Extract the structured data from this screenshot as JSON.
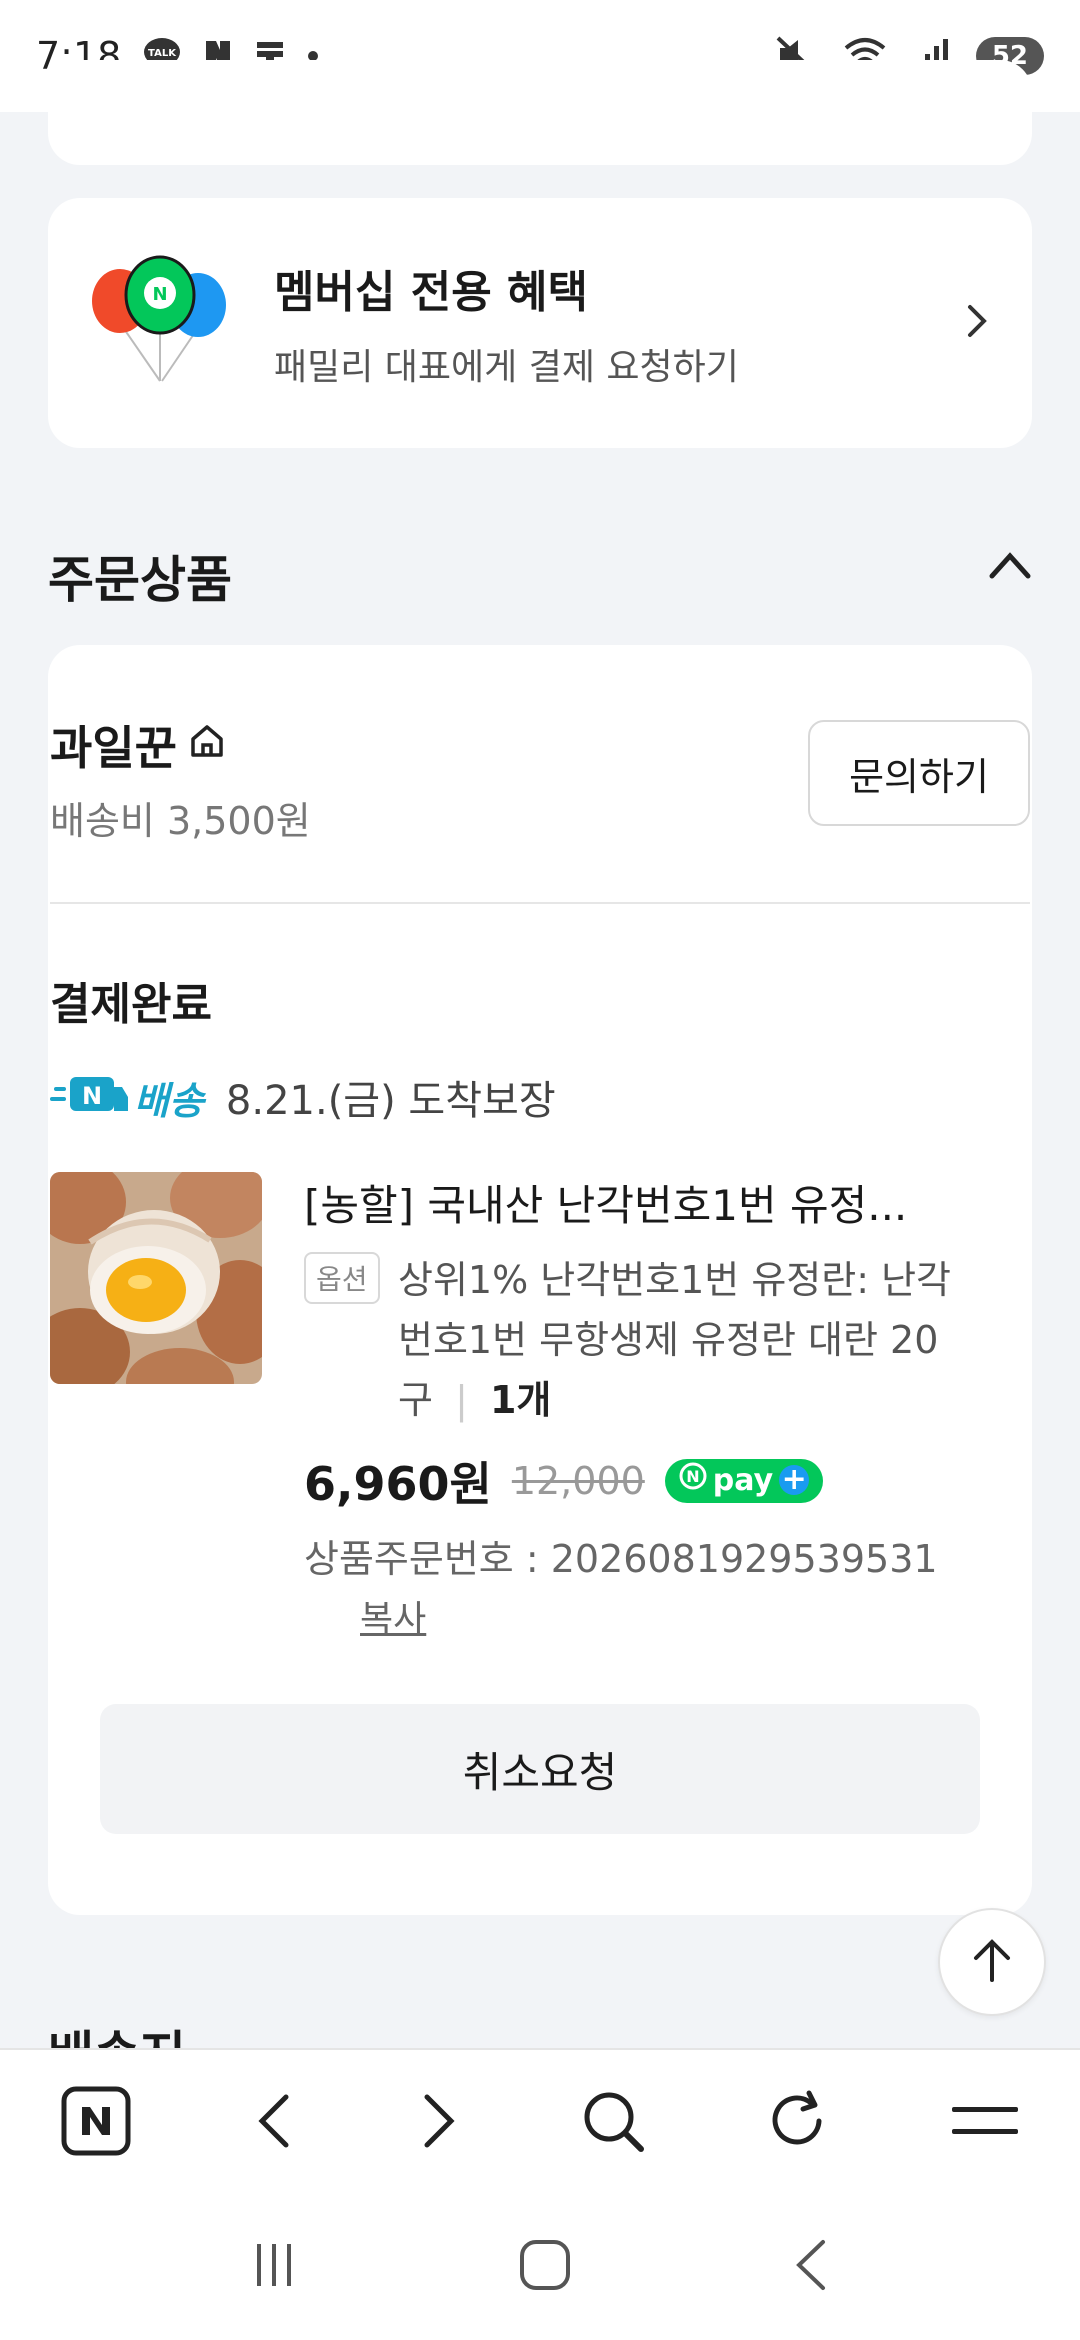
{
  "status_bar": {
    "time": "7:18",
    "battery": "52",
    "icons": [
      "talk-icon",
      "naver-icon",
      "notification-icon",
      "dot-icon",
      "mute-icon",
      "wifi-icon",
      "signal-icon"
    ]
  },
  "membership": {
    "title": "멤버십 전용 혜택",
    "subtitle": "패밀리 대표에게 결제 요청하기"
  },
  "order_section": {
    "title": "주문상품",
    "seller": {
      "name": "과일꾼",
      "shipping_fee": "배송비 3,500원",
      "inquiry_label": "문의하기"
    },
    "payment_status": "결제완료",
    "delivery": {
      "label": "배송",
      "date_text": "8.21.(금) 도착보장"
    },
    "product": {
      "name": "[농할] 국내산 난각번호1번 유정...",
      "option_tag": "옵션",
      "option_text": "상위1% 난각번호1번 유정란: 난각번호1번 무항생제 유정란 대란 20구",
      "qty_sep": "|",
      "quantity": "1개",
      "price": "6,960원",
      "original_price": "12,000",
      "npay_label": "pay",
      "order_number": "상품주문번호 : 2026081929539531",
      "copy_label": "복사"
    },
    "cancel_label": "취소요청"
  },
  "next_section_title": "배송지",
  "colors": {
    "background": "#f2f4f7",
    "npay_green": "#03c75a",
    "delivery_blue": "#1aa3c9"
  }
}
